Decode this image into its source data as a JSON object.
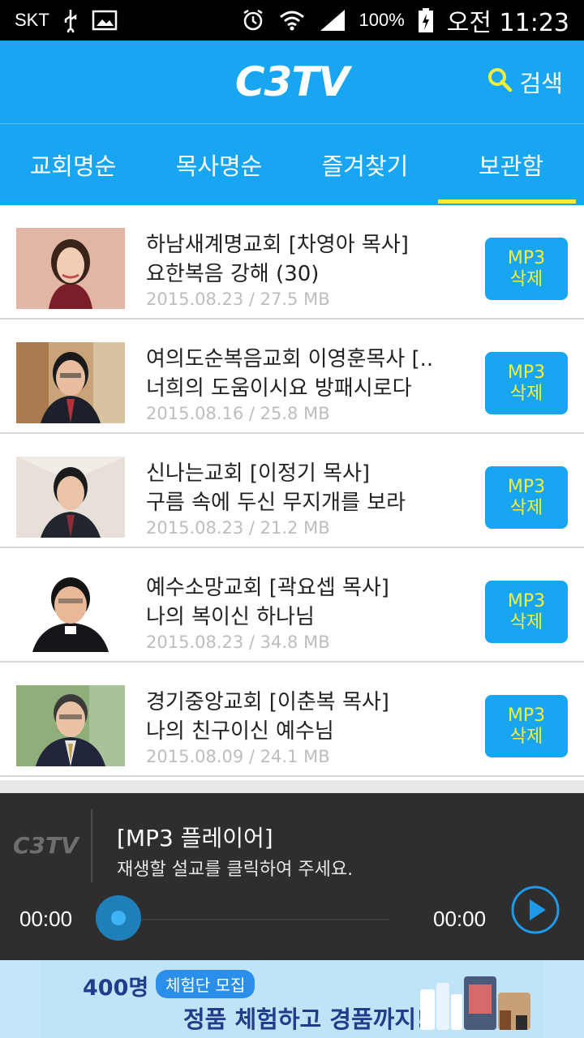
{
  "status_bar": {
    "carrier": "SKT",
    "battery": "100%",
    "time": "오전 11:23"
  },
  "header": {
    "logo": "C3TV",
    "search_label": "검색"
  },
  "tabs": [
    {
      "label": "교회명순",
      "active": false
    },
    {
      "label": "목사명순",
      "active": false
    },
    {
      "label": "즐겨찾기",
      "active": false
    },
    {
      "label": "보관함",
      "active": true
    }
  ],
  "items": [
    {
      "line1": "하남새계명교회 [차영아 목사]",
      "line2": "요한복음 강해 (30)",
      "meta": "2015.08.23 / 27.5 MB",
      "btn1": "MP3",
      "btn2": "삭제"
    },
    {
      "line1": "여의도순복음교회 이영훈목사 [..",
      "line2": "너희의 도움이시요 방패시로다",
      "meta": "2015.08.16 / 25.8 MB",
      "btn1": "MP3",
      "btn2": "삭제"
    },
    {
      "line1": "신나는교회 [이정기 목사]",
      "line2": "구름 속에 두신 무지개를 보라",
      "meta": "2015.08.23 / 21.2 MB",
      "btn1": "MP3",
      "btn2": "삭제"
    },
    {
      "line1": "예수소망교회 [곽요셉 목사]",
      "line2": "나의 복이신 하나님",
      "meta": "2015.08.23 / 34.8 MB",
      "btn1": "MP3",
      "btn2": "삭제"
    },
    {
      "line1": "경기중앙교회 [이춘복 목사]",
      "line2": "나의 친구이신 예수님",
      "meta": "2015.08.09 / 24.1 MB",
      "btn1": "MP3",
      "btn2": "삭제"
    }
  ],
  "player": {
    "logo": "C3TV",
    "title": "[MP3 플레이어]",
    "subtitle": "재생할 설교를 클릭하여 주세요.",
    "time_current": "00:00",
    "time_total": "00:00"
  },
  "ad": {
    "count": "400명",
    "badge": "체험단 모집",
    "line2": "정품 체험하고 경품까지!"
  },
  "colors": {
    "primary": "#18a6f3",
    "button_text": "#f7f03a",
    "tab_indicator": "#f6ee3a",
    "player_bg": "#2e2e2e"
  }
}
